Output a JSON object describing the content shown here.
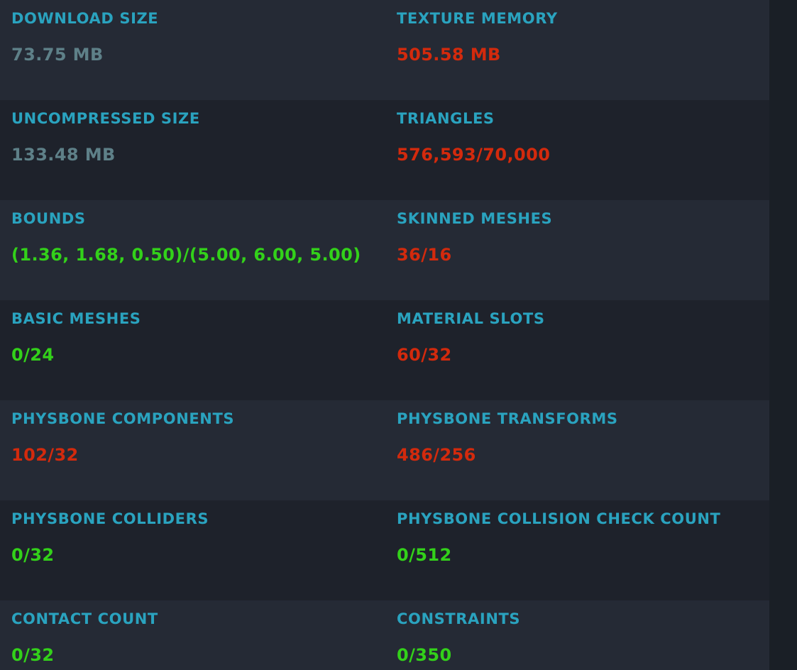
{
  "colors": {
    "label": "#2aa3bf",
    "neutral": "#5e8088",
    "over_limit": "#d32a0d",
    "within_limit": "#33d11a",
    "row_odd": "#252a35",
    "row_even": "#1e222b",
    "background": "#1a1f26"
  },
  "stats": [
    {
      "left": {
        "label": "DOWNLOAD SIZE",
        "value": "73.75 MB",
        "status": "neutral"
      },
      "right": {
        "label": "TEXTURE MEMORY",
        "value": "505.58 MB",
        "status": "over"
      }
    },
    {
      "left": {
        "label": "UNCOMPRESSED SIZE",
        "value": "133.48 MB",
        "status": "neutral"
      },
      "right": {
        "label": "TRIANGLES",
        "value": "576,593/70,000",
        "status": "over"
      }
    },
    {
      "left": {
        "label": "BOUNDS",
        "value": "(1.36, 1.68, 0.50)/(5.00, 6.00, 5.00)",
        "status": "ok"
      },
      "right": {
        "label": "SKINNED MESHES",
        "value": "36/16",
        "status": "over"
      }
    },
    {
      "left": {
        "label": "BASIC MESHES",
        "value": "0/24",
        "status": "ok"
      },
      "right": {
        "label": "MATERIAL SLOTS",
        "value": "60/32",
        "status": "over"
      }
    },
    {
      "left": {
        "label": "PHYSBONE COMPONENTS",
        "value": "102/32",
        "status": "over"
      },
      "right": {
        "label": "PHYSBONE TRANSFORMS",
        "value": "486/256",
        "status": "over"
      }
    },
    {
      "left": {
        "label": "PHYSBONE COLLIDERS",
        "value": "0/32",
        "status": "ok"
      },
      "right": {
        "label": "PHYSBONE COLLISION CHECK COUNT",
        "value": "0/512",
        "status": "ok"
      }
    },
    {
      "left": {
        "label": "CONTACT COUNT",
        "value": "0/32",
        "status": "ok"
      },
      "right": {
        "label": "CONSTRAINTS",
        "value": "0/350",
        "status": "ok"
      }
    }
  ]
}
